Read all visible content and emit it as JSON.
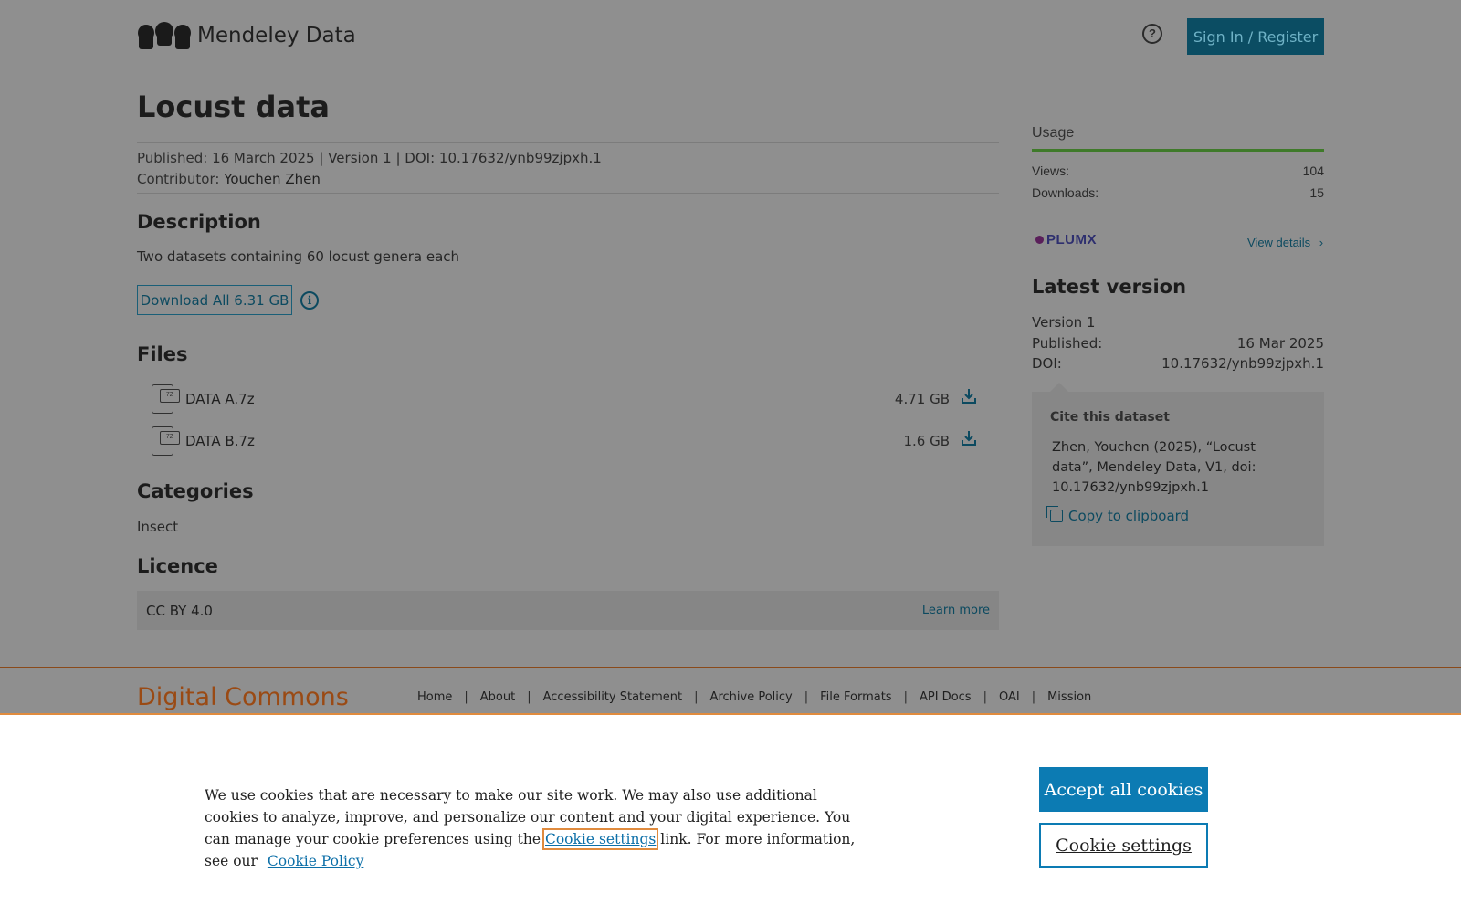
{
  "header": {
    "logo_text": "Mendeley Data",
    "help_icon": "question-circle-icon",
    "signin_label": "Sign In / Register"
  },
  "dataset": {
    "title": "Locust data",
    "published_label": "Published:",
    "published_date": "16 March 2025",
    "version": "Version 1",
    "doi_label": "DOI:",
    "doi": "10.17632/ynb99zjpxh.1",
    "contributor_label": "Contributor:",
    "contributor": "Youchen Zhen"
  },
  "description": {
    "heading": "Description",
    "text": "Two datasets containing 60 locust genera each",
    "download_label": "Download All 6.31 GB",
    "info_icon": "info-circle-icon"
  },
  "files": {
    "heading": "Files",
    "items": [
      {
        "name": "DATA A.7z",
        "size": "4.71 GB",
        "type_tag": "7Z"
      },
      {
        "name": "DATA B.7z",
        "size": "1.6 GB",
        "type_tag": "7Z"
      }
    ]
  },
  "categories": {
    "heading": "Categories",
    "items": [
      "Insect"
    ]
  },
  "licence": {
    "heading": "Licence",
    "name": "CC BY 4.0",
    "learn_more": "Learn more"
  },
  "usage": {
    "heading": "Usage",
    "views_label": "Views:",
    "views": "104",
    "downloads_label": "Downloads:",
    "downloads": "15",
    "plumx": "PLUMX",
    "view_details": "View details"
  },
  "latest_version": {
    "heading": "Latest version",
    "version": "Version 1",
    "published_label": "Published:",
    "published": "16 Mar 2025",
    "doi_label": "DOI:",
    "doi": "10.17632/ynb99zjpxh.1"
  },
  "cite": {
    "heading": "Cite this dataset",
    "text": "Zhen, Youchen (2025), “Locust data”, Mendeley Data, V1, doi: 10.17632/ynb99zjpxh.1",
    "copy_label": "Copy to clipboard"
  },
  "footer": {
    "logo": "Digital Commons",
    "nav": [
      "Home",
      "About",
      "Accessibility Statement",
      "Archive Policy",
      "File Formats",
      "API Docs",
      "OAI",
      "Mission"
    ]
  },
  "cookie_banner": {
    "text_before": "We use cookies that are necessary to make our site work. We may also use additional cookies to analyze, improve, and personalize our content and your digital experience. You can manage your cookie preferences using the",
    "settings_link": "Cookie settings",
    "text_middle": "link. For more information, see our",
    "policy_link": "Cookie Policy",
    "accept_label": "Accept all cookies",
    "settings_label": "Cookie settings"
  },
  "colors": {
    "accent": "#0c7bb3",
    "header_button": "#0b4d63",
    "usage_line": "#3f7a2a",
    "footer_brand": "#9a4a14",
    "overlay_bg": "#8f8f8f"
  }
}
